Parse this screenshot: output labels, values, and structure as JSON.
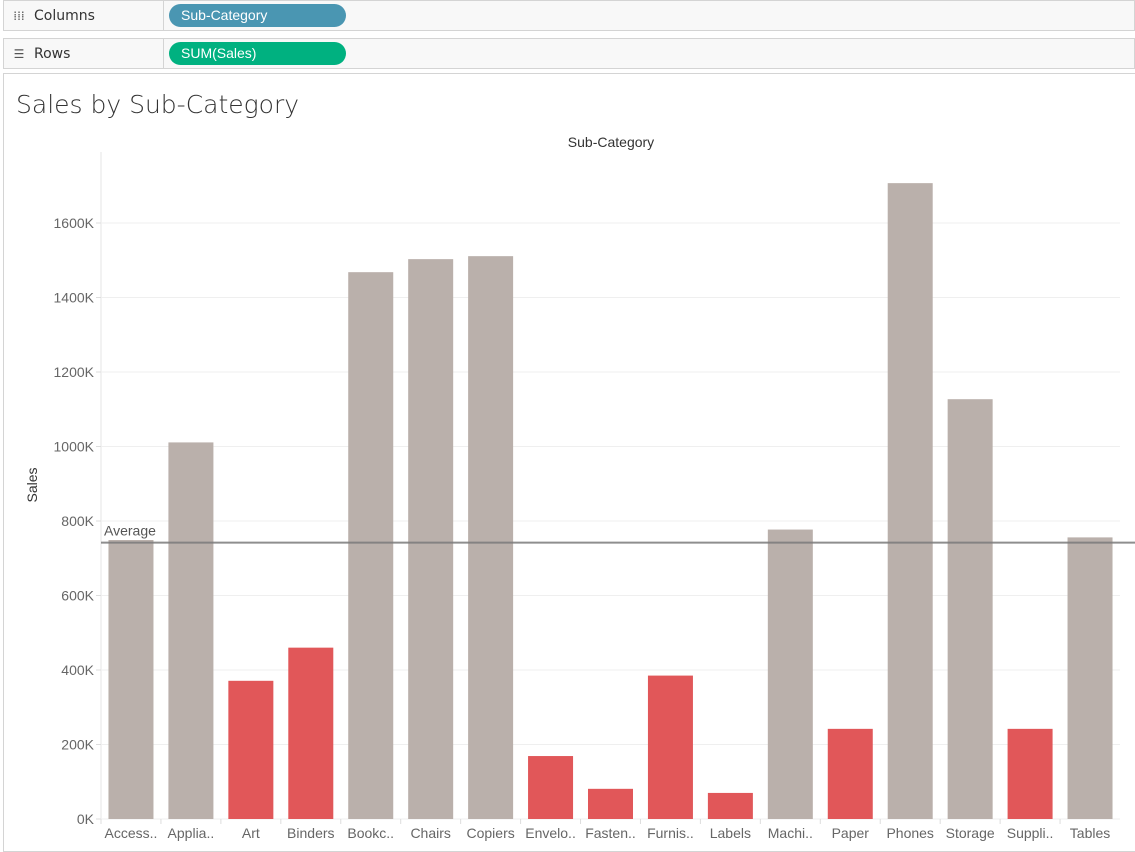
{
  "shelves": {
    "columns": {
      "label": "Columns",
      "icon": "columns-icon",
      "pill": "Sub-Category",
      "pill_color": "#4a96b2"
    },
    "rows": {
      "label": "Rows",
      "icon": "rows-icon",
      "pill": "SUM(Sales)",
      "pill_color": "#00b180"
    }
  },
  "chart_data": {
    "type": "bar",
    "title": "Sales by Sub-Category",
    "xlabel": "Sub-Category",
    "ylabel": "Sales",
    "ylim": [
      0,
      1750
    ],
    "yticks": [
      0,
      200,
      400,
      600,
      800,
      1000,
      1200,
      1400,
      1600
    ],
    "ytick_labels": [
      "0K",
      "200K",
      "400K",
      "600K",
      "800K",
      "1000K",
      "1200K",
      "1400K",
      "1600K"
    ],
    "categories": [
      "Access..",
      "Applia..",
      "Art",
      "Binders",
      "Bookc..",
      "Chairs",
      "Copiers",
      "Envelo..",
      "Fasten..",
      "Furnis..",
      "Labels",
      "Machi..",
      "Paper",
      "Phones",
      "Storage",
      "Suppli..",
      "Tables"
    ],
    "values": [
      749,
      1011,
      371,
      460,
      1468,
      1503,
      1511,
      169,
      81,
      385,
      70,
      777,
      242,
      1707,
      1127,
      242,
      756
    ],
    "reference_line": {
      "label": "Average",
      "value": 742,
      "color": "#7a7a7a"
    },
    "colors": {
      "above": "#bab0ab",
      "below": "#e15759"
    },
    "grid": true
  }
}
